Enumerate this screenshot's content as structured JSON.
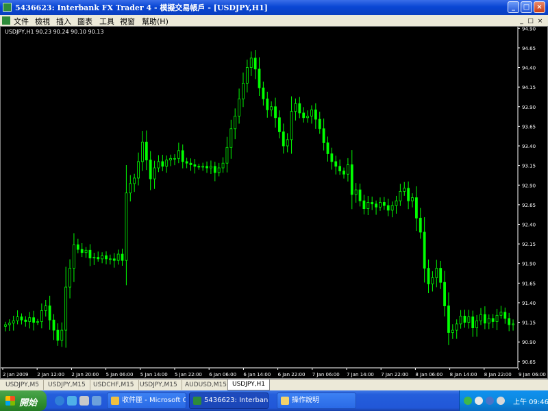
{
  "window": {
    "title": "5436623: Interbank FX Trader 4 - 模擬交易帳戶 - [USDJPY,H1]",
    "controls": [
      "_",
      "□",
      "×"
    ]
  },
  "menu": {
    "items": [
      "文件",
      "檢視",
      "插入",
      "圖表",
      "工具",
      "視窗",
      "幫助(H)"
    ],
    "mdi_controls": [
      "_",
      "□",
      "×"
    ]
  },
  "chart": {
    "symbol_label": "USDJPY,H1  90.23 90.24 90.10 90.13",
    "background": "#000000",
    "bull_color": "#ffffff",
    "bear_color": "#00ff00"
  },
  "chart_data": {
    "type": "candlestick",
    "symbol": "USDJPY",
    "timeframe": "H1",
    "y_ticks": [
      "94.90",
      "94.65",
      "94.40",
      "94.15",
      "93.90",
      "93.65",
      "93.40",
      "93.15",
      "92.90",
      "92.65",
      "92.40",
      "92.15",
      "91.90",
      "91.65",
      "91.40",
      "91.15",
      "90.90",
      "90.65"
    ],
    "ylim": [
      90.57,
      94.92
    ],
    "x_ticks": [
      "2 Jan 2009",
      "2 Jan 12:00",
      "2 Jan 20:00",
      "5 Jan 06:00",
      "5 Jan 14:00",
      "5 Jan 22:00",
      "6 Jan 06:00",
      "6 Jan 14:00",
      "6 Jan 22:00",
      "7 Jan 06:00",
      "7 Jan 14:00",
      "7 Jan 22:00",
      "8 Jan 06:00",
      "8 Jan 14:00",
      "8 Jan 22:00",
      "9 Jan 06:00"
    ],
    "close": [
      91.12,
      91.14,
      91.17,
      91.22,
      91.18,
      91.16,
      91.21,
      91.15,
      91.16,
      91.3,
      91.36,
      91.18,
      91.05,
      90.92,
      91.05,
      91.6,
      91.84,
      92.14,
      92.08,
      92.04,
      92.07,
      91.97,
      91.98,
      91.96,
      92.0,
      91.96,
      91.96,
      91.94,
      92.02,
      91.94,
      92.8,
      92.92,
      92.99,
      93.2,
      93.45,
      93.22,
      92.98,
      93.12,
      93.2,
      93.14,
      93.22,
      93.24,
      93.24,
      93.34,
      93.2,
      93.18,
      93.16,
      93.14,
      93.13,
      93.14,
      93.12,
      93.14,
      93.06,
      93.12,
      93.18,
      93.38,
      93.62,
      93.78,
      94.0,
      94.2,
      94.4,
      94.52,
      94.38,
      94.14,
      94.0,
      93.86,
      93.9,
      93.76,
      93.58,
      93.4,
      93.48,
      93.84,
      93.94,
      93.82,
      93.76,
      93.78,
      93.86,
      93.74,
      93.62,
      93.44,
      93.3,
      93.2,
      93.14,
      93.08,
      93.04,
      93.16,
      92.78,
      92.84,
      92.7,
      92.6,
      92.68,
      92.66,
      92.62,
      92.68,
      92.64,
      92.58,
      92.64,
      92.7,
      92.82,
      92.86,
      92.7,
      92.74,
      92.48,
      92.3,
      91.84,
      91.64,
      91.72,
      91.84,
      91.66,
      91.36,
      91.02,
      91.05,
      91.13,
      91.23,
      91.15,
      91.22,
      91.08,
      91.17,
      91.25,
      91.14,
      91.2,
      91.16,
      91.24,
      91.28,
      91.2,
      91.12,
      91.13
    ]
  },
  "tabs": [
    "USDJPY,M5",
    "USDJPY,M15",
    "USDCHF,M15",
    "USDJPY,M15",
    "AUDUSD,M15",
    "USDJPY,H1"
  ],
  "taskbar": {
    "start_label": "開始",
    "tasks": [
      "收件匣 - Microsoft O...",
      "5436623: Interbank F...",
      "操作說明"
    ],
    "clock": "上午 09:46"
  },
  "colors": {
    "titlebar": "#0a46d4",
    "taskbar": "#245edb",
    "start": "#2f8f2f",
    "tray": "#0c8ae0"
  }
}
